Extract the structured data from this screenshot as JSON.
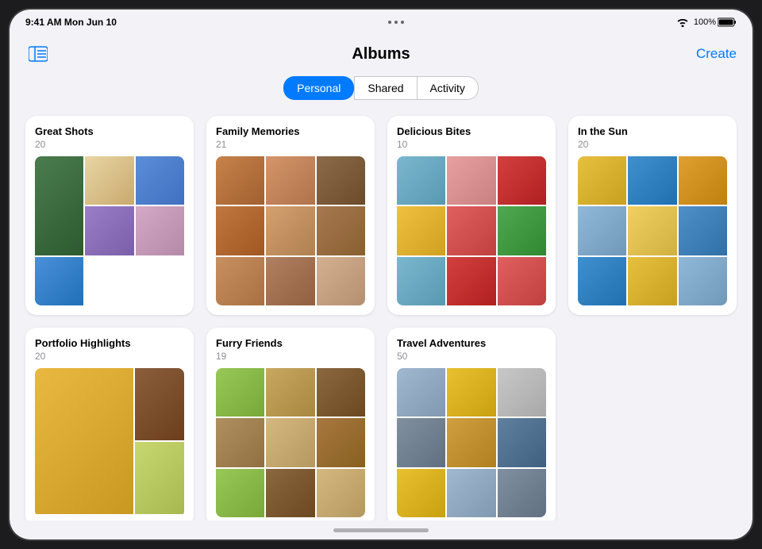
{
  "statusBar": {
    "time": "9:41 AM",
    "date": "Mon Jun 10",
    "battery": "100%",
    "wifiStrength": "full"
  },
  "header": {
    "title": "Albums",
    "createLabel": "Create",
    "sidebarToggleTitle": "Toggle Sidebar"
  },
  "tabs": [
    {
      "id": "personal",
      "label": "Personal",
      "active": true
    },
    {
      "id": "shared",
      "label": "Shared",
      "active": false
    },
    {
      "id": "activity",
      "label": "Activity",
      "active": false
    }
  ],
  "albums": [
    {
      "id": "great-shots",
      "title": "Great Shots",
      "count": "20",
      "colorScheme": "gs"
    },
    {
      "id": "family-memories",
      "title": "Family Memories",
      "count": "21",
      "colorScheme": "fm"
    },
    {
      "id": "delicious-bites",
      "title": "Delicious Bites",
      "count": "10",
      "colorScheme": "db"
    },
    {
      "id": "in-the-sun",
      "title": "In the Sun",
      "count": "20",
      "colorScheme": "is"
    },
    {
      "id": "portfolio-highlights",
      "title": "Portfolio Highlights",
      "count": "20",
      "colorScheme": "ph"
    },
    {
      "id": "furry-friends",
      "title": "Furry Friends",
      "count": "19",
      "colorScheme": "ff"
    },
    {
      "id": "travel-adventures",
      "title": "Travel Adventures",
      "count": "50",
      "colorScheme": "ta"
    }
  ],
  "homeIndicator": {
    "visible": true
  }
}
